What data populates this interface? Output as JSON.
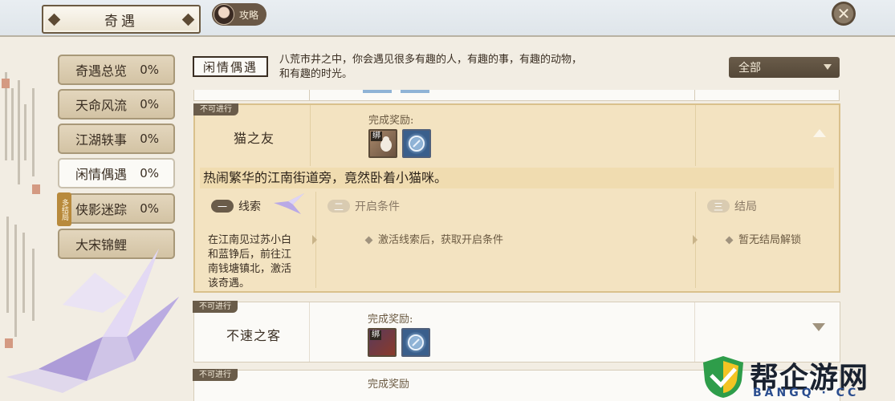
{
  "header": {
    "title": "奇遇",
    "guide_label": "攻略",
    "close_glyph": "✕"
  },
  "sidebar": {
    "items": [
      {
        "label": "奇遇总览",
        "percent": "0%",
        "active": false,
        "multi": ""
      },
      {
        "label": "天命风流",
        "percent": "0%",
        "active": false,
        "multi": ""
      },
      {
        "label": "江湖轶事",
        "percent": "0%",
        "active": false,
        "multi": ""
      },
      {
        "label": "闲情偶遇",
        "percent": "0%",
        "active": true,
        "multi": ""
      },
      {
        "label": "侠影迷踪",
        "percent": "0%",
        "active": false,
        "multi": "多结局"
      },
      {
        "label": "大宋锦鲤",
        "percent": "",
        "active": false,
        "multi": ""
      }
    ]
  },
  "category": {
    "badge": "闲情偶遇",
    "desc_line1": "八荒市井之中，你会遇见很多有趣的人，有趣的事，有趣的动物，",
    "desc_line2": "和有趣的时光。"
  },
  "filter": {
    "selected": "全部"
  },
  "encounters": [
    {
      "status": "不可进行",
      "name": "猫之友",
      "reward_label": "完成奖励:",
      "rewards": [
        {
          "icon": "cat-figurine-icon",
          "bound": "绑"
        },
        {
          "icon": "skill-orb-icon",
          "bound": ""
        }
      ],
      "expanded": true,
      "story": "热闹繁华的江南街道旁，竟然卧着小猫咪。",
      "steps": [
        {
          "num": "一",
          "title": "线索",
          "text_lines": [
            "在江南见过苏小白",
            "和蓝铮后，前往江",
            "南钱塘镇北，激活",
            "该奇遇。"
          ]
        },
        {
          "num": "二",
          "title": "开启条件",
          "text": "激活线索后，获取开启条件"
        },
        {
          "num": "三",
          "title": "结局",
          "text": "暂无结局解锁"
        }
      ]
    },
    {
      "status": "不可进行",
      "name": "不速之客",
      "reward_label": "完成奖励:",
      "rewards": [
        {
          "icon": "red-token-icon",
          "bound": "绑"
        },
        {
          "icon": "skill-orb-icon",
          "bound": ""
        }
      ],
      "expanded": false
    },
    {
      "status": "不可进行",
      "name": "",
      "reward_label": "完成奖励",
      "expanded": false
    }
  ],
  "watermark": {
    "text": "帮企游网",
    "url": "BANGQ · CC"
  }
}
